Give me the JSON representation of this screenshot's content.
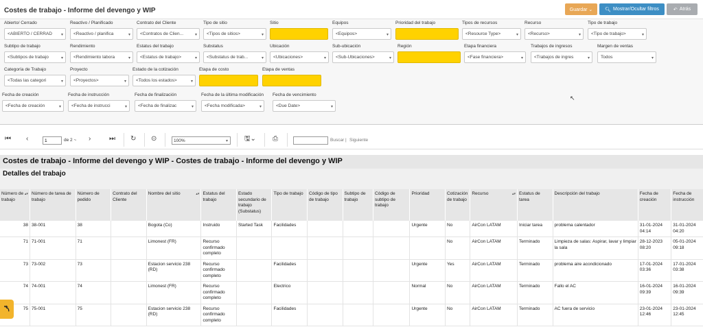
{
  "header": {
    "title": "Costes de trabajo - Informe del devengo y WIP",
    "buttons": {
      "guardar": "Guardar ⌄",
      "mostrar": "Mostrar/Ocultar filtros",
      "atras": "Atrás"
    }
  },
  "filters": {
    "abierto": {
      "label": "Abierto/ Cerrado",
      "value": "<ABIERTO / CERRAD"
    },
    "reactivo": {
      "label": "Reactivo / Planificado",
      "value": "<Reactivo / planifica"
    },
    "contrato": {
      "label": "Contrato del Cliente",
      "value": "<Contratos de Clien..."
    },
    "tipo_sitio": {
      "label": "Tipo de sitio",
      "value": "<Tipos de sitios>"
    },
    "sitio": {
      "label": "Sitio",
      "value": ""
    },
    "equipos": {
      "label": "Equipos",
      "value": "<Equipos>"
    },
    "prioridad": {
      "label": "Prioridad del trabajo",
      "value": ""
    },
    "tipos_recursos": {
      "label": "Tipos de recursos",
      "value": "<Resource Type>"
    },
    "recurso": {
      "label": "Recurso",
      "value": "<Recurso>"
    },
    "tipo_trabajo": {
      "label": "Tipo de trabajo",
      "value": "<Tipo de trabajo>"
    },
    "subtipo": {
      "label": "Subtipo de trabajo",
      "value": "<Subtipos de trabajo"
    },
    "rendimiento": {
      "label": "Rendimiento",
      "value": "<Rendimiento labora"
    },
    "estatus": {
      "label": "Estatus del trabajo",
      "value": "<Estatus de trabajo>"
    },
    "substatus": {
      "label": "Substatus",
      "value": "<Substatus de trab..."
    },
    "ubicacion": {
      "label": "Ubicación",
      "value": "<Ubicaciones>"
    },
    "sububicacion": {
      "label": "Sub-ubicación",
      "value": "<Sub-Ubicaciones>"
    },
    "region": {
      "label": "Región",
      "value": ""
    },
    "etapa_financiera": {
      "label": "Etapa financiera",
      "value": "<Fase financiera>"
    },
    "trabajos_ingresos": {
      "label": "Trabajos de ingresos",
      "value": "<Trabajos de ingres"
    },
    "margen": {
      "label": "Margen de ventas",
      "value": "Todos"
    },
    "categoria": {
      "label": "Categoría de Trabajo",
      "value": "<Todas las categori"
    },
    "proyecto": {
      "label": "Proyecto",
      "value": "<Proyectos>"
    },
    "estado_cotizacion": {
      "label": "Estado de la cotización",
      "value": "<Todos los estados>"
    },
    "etapa_costo": {
      "label": "Etapa de costo",
      "value": ""
    },
    "etapa_ventas": {
      "label": "Etapa de ventas",
      "value": ""
    },
    "fecha_creacion": {
      "label": "Fecha de creación",
      "value": "<Fecha de creación"
    },
    "fecha_instruccion": {
      "label": "Fecha de instrucción",
      "value": "<Fecha de instrucci"
    },
    "fecha_finalizacion": {
      "label": "Fecha de finalización",
      "value": "<Fecha de finalizac"
    },
    "fecha_modificacion": {
      "label": "Fecha de la última modificación",
      "value": "<Fecha modificada>"
    },
    "fecha_vencimiento": {
      "label": "Fecha de vencimiento",
      "value": "<Due Date>"
    }
  },
  "toolbar": {
    "page": "1",
    "page_of": "de 2 ~",
    "zoom": "100%",
    "find_placeholder": "",
    "find_label": "Buscar",
    "next_label": "Siguiente"
  },
  "report": {
    "title": "Costes de trabajo - Informe del devengo y WIP - Costes de trabajo - Informe del devengo y WIP",
    "section": "Detalles del trabajo",
    "columns": [
      "Número de trabajo",
      "Número de tarea de trabajo",
      "Número de pedido",
      "Contrato del Cliente",
      "Nombre del sitio",
      "Estatus del trabajo",
      "Estado secundario de trabajo (Substatus)",
      "Tipo de trabajo",
      "Código de tipo de trabajo",
      "Subtipo de trabajo",
      "Código de subtipo de trabajo",
      "Prioridad",
      "Cotización de trabajo",
      "Recurso",
      "Estatus de tarea",
      "Descripción del trabajo",
      "Fecha de creación",
      "Fecha de instrucción"
    ],
    "rows": [
      [
        "38",
        "38-001",
        "38",
        "",
        "Bogota (Co)",
        "Instruido",
        "Started Task",
        "Facilidades",
        "",
        "",
        "",
        "Urgente",
        "No",
        "AirCon LATAM",
        "Iniciar tarea",
        "problema calentador",
        "31-01-2024 04:14",
        "31-01-2024 04:20"
      ],
      [
        "71",
        "71-001",
        "71",
        "",
        "Limonest (FR)",
        "Recurso confirmado completo",
        "",
        "",
        "",
        "",
        "",
        "",
        "No",
        "AirCon LATAM",
        "Terminado",
        "Limpieza de salas: Aspirar, lavar y limpiar la sala",
        "28-12-2023 08:20",
        "05-01-2024 09:18"
      ],
      [
        "73",
        "73-002",
        "73",
        "",
        "Estacion servicio 238 (RD)",
        "Recurso confirmado completo",
        "",
        "Facilidades",
        "",
        "",
        "",
        "Urgente",
        "Yes",
        "AirCon LATAM",
        "Terminado",
        "problema aire acondicionado",
        "17-01-2024 03:36",
        "17-01-2024 03:38"
      ],
      [
        "74",
        "74-001",
        "74",
        "",
        "Limonest (FR)",
        "Recurso confirmado completo",
        "",
        "Electrico",
        "",
        "",
        "",
        "Normal",
        "No",
        "AirCon LATAM",
        "Terminado",
        "Fallo el AC",
        "16-01-2024 09:39",
        "16-01-2024 09:39"
      ],
      [
        "75",
        "75-001",
        "75",
        "",
        "Estacion servicio 238 (RD)",
        "Recurso confirmado completo",
        "",
        "Facilidades",
        "",
        "",
        "",
        "Urgente",
        "No",
        "AirCon LATAM",
        "Terminado",
        "AC fuera de servicio",
        "23-01-2024 12:46",
        "23-01-2024 12:45"
      ]
    ]
  }
}
